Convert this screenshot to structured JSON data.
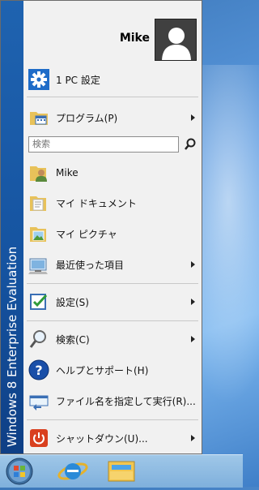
{
  "menu": {
    "banner": "Windows 8 Enterprise Evaluation",
    "user": {
      "name": "Mike"
    },
    "pc_settings": {
      "label": "1 PC 設定"
    },
    "programs": {
      "label": "プログラム(P)"
    },
    "search": {
      "placeholder": "検索"
    },
    "places": [
      {
        "label": "Mike"
      },
      {
        "label": "マイ ドキュメント"
      },
      {
        "label": "マイ ピクチャ"
      },
      {
        "label": "最近使った項目"
      }
    ],
    "settings": {
      "label": "設定(S)"
    },
    "find": {
      "label": "検索(C)"
    },
    "help": {
      "label": "ヘルプとサポート(H)"
    },
    "run": {
      "label": "ファイル名を指定して実行(R)..."
    },
    "shutdown": {
      "label": "シャットダウン(U)..."
    }
  },
  "colors": {
    "banner": "#1553a0",
    "accent_blue": "#1e6cc8",
    "shutdown_red": "#d9401f"
  },
  "taskbar": {
    "icons": [
      "start-orb-icon",
      "internet-explorer-icon",
      "file-explorer-icon"
    ]
  }
}
